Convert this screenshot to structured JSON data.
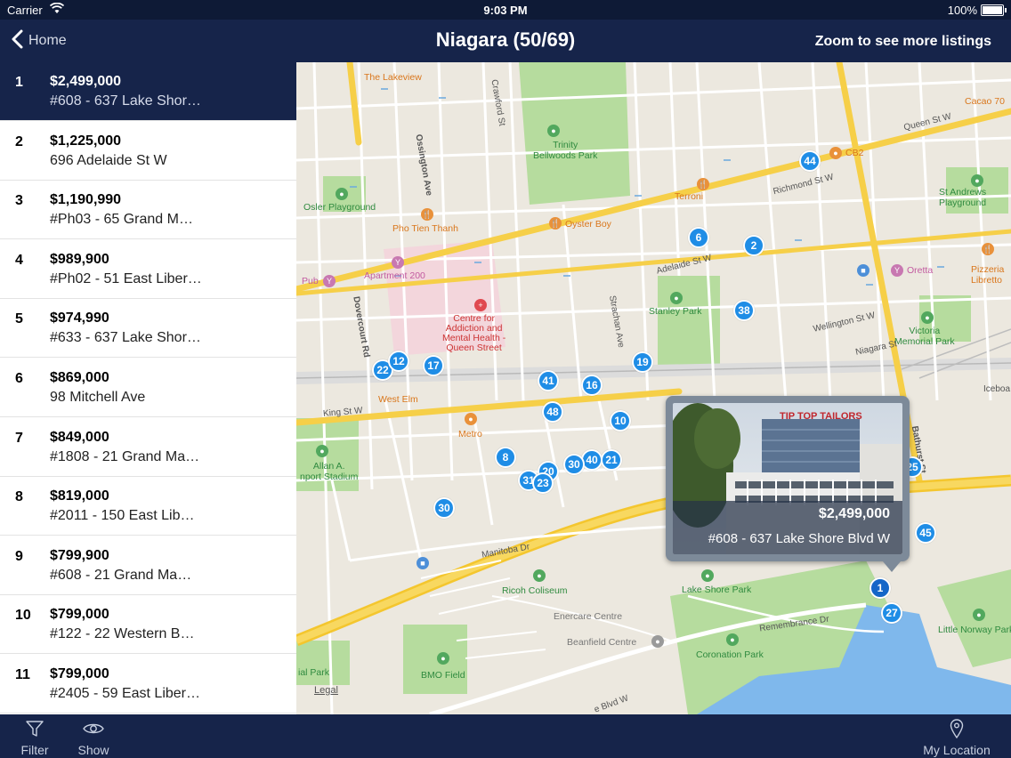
{
  "status_bar": {
    "carrier": "Carrier",
    "time": "9:03 PM",
    "battery": "100%"
  },
  "nav": {
    "back_label": "Home",
    "title": "Niagara (50/69)",
    "right_label": "Zoom to see more listings"
  },
  "listings": [
    {
      "index": "1",
      "price": "$2,499,000",
      "address": "#608 - 637 Lake Shor…",
      "selected": true
    },
    {
      "index": "2",
      "price": "$1,225,000",
      "address": "696 Adelaide St W"
    },
    {
      "index": "3",
      "price": "$1,190,990",
      "address": "#Ph03 - 65 Grand M…"
    },
    {
      "index": "4",
      "price": "$989,900",
      "address": "#Ph02 - 51 East Liber…"
    },
    {
      "index": "5",
      "price": "$974,990",
      "address": "#633 - 637 Lake Shor…"
    },
    {
      "index": "6",
      "price": "$869,000",
      "address": "98 Mitchell Ave"
    },
    {
      "index": "7",
      "price": "$849,000",
      "address": "#1808 - 21 Grand Ma…"
    },
    {
      "index": "8",
      "price": "$819,000",
      "address": "#2011 - 150 East Lib…"
    },
    {
      "index": "9",
      "price": "$799,900",
      "address": "#608 - 21 Grand Ma…"
    },
    {
      "index": "10",
      "price": "$799,000",
      "address": "#122 - 22 Western B…"
    },
    {
      "index": "11",
      "price": "$799,000",
      "address": "#2405 - 59 East Liber…"
    }
  ],
  "map": {
    "labels": {
      "lakeview": "The Lakeview",
      "trinity": "Trinity\nBellwoods Park",
      "osler": "Osler Playground",
      "pho": "Pho Tien Thanh",
      "oyster": "Oyster Boy",
      "terroni": "Terroni",
      "cb2": "CB2",
      "cacao": "Cacao 70",
      "standrews": "St Andrews\nPlayground",
      "apartment": "Apartment 200",
      "pub": "Pub",
      "camh": "Centre for\nAddiction and\nMental Health -\nQueen Street",
      "stanley": "Stanley Park",
      "oretta": "Oretta",
      "pizzeria": "Pizzeria\nLibretto",
      "victoria": "Victoria\nMemorial Park",
      "westelm": "West Elm",
      "metro": "Metro",
      "allan": "Allan A.\nnport Stadium",
      "ricoh": "Ricoh Coliseum",
      "enercare": "Enercare Centre",
      "beanfield": "Beanfield Centre",
      "lakeshore_park": "Lake Shore Park",
      "coronation": "Coronation Park",
      "bmo": "BMO Field",
      "ial_park": "ial Park",
      "little_norway": "Little Norway Park",
      "queen_st_w": "Queen St W",
      "king_st_w": "King St W",
      "richmond": "Richmond St W",
      "adelaide": "Adelaide St W",
      "wellington": "Wellington St W",
      "niagara_st": "Niagara St",
      "ossington": "Ossington Ave",
      "dovercourt": "Dovercourt Rd",
      "crawford": "Crawford St",
      "strachan": "Strachan Ave",
      "bathurst": "Bathurst St",
      "remembrance": "Remembrance Dr",
      "manitoba": "Manitoba Dr",
      "fleet": "e Blvd W",
      "icebo": "Iceboa",
      "legal": "Legal"
    },
    "pins": [
      "44",
      "6",
      "2",
      "38",
      "22",
      "12",
      "17",
      "19",
      "41",
      "16",
      "48",
      "10",
      "8",
      "40",
      "21",
      "20",
      "31",
      "23",
      "30",
      "25",
      "45",
      "1",
      "27"
    ]
  },
  "callout": {
    "price": "$2,499,000",
    "address": "#608 - 637 Lake Shore Blvd W",
    "sign_text": "TIP TOP TAILORS"
  },
  "tab_bar": {
    "filter_label": "Filter",
    "show_label": "Show",
    "location_label": "My Location"
  },
  "colors": {
    "nav_bg": "#16244a",
    "pin_blue": "#1f8de6",
    "park_green": "#b6dc9e",
    "water_blue": "#7fb8ec",
    "highway_yellow": "#f6cf48"
  }
}
